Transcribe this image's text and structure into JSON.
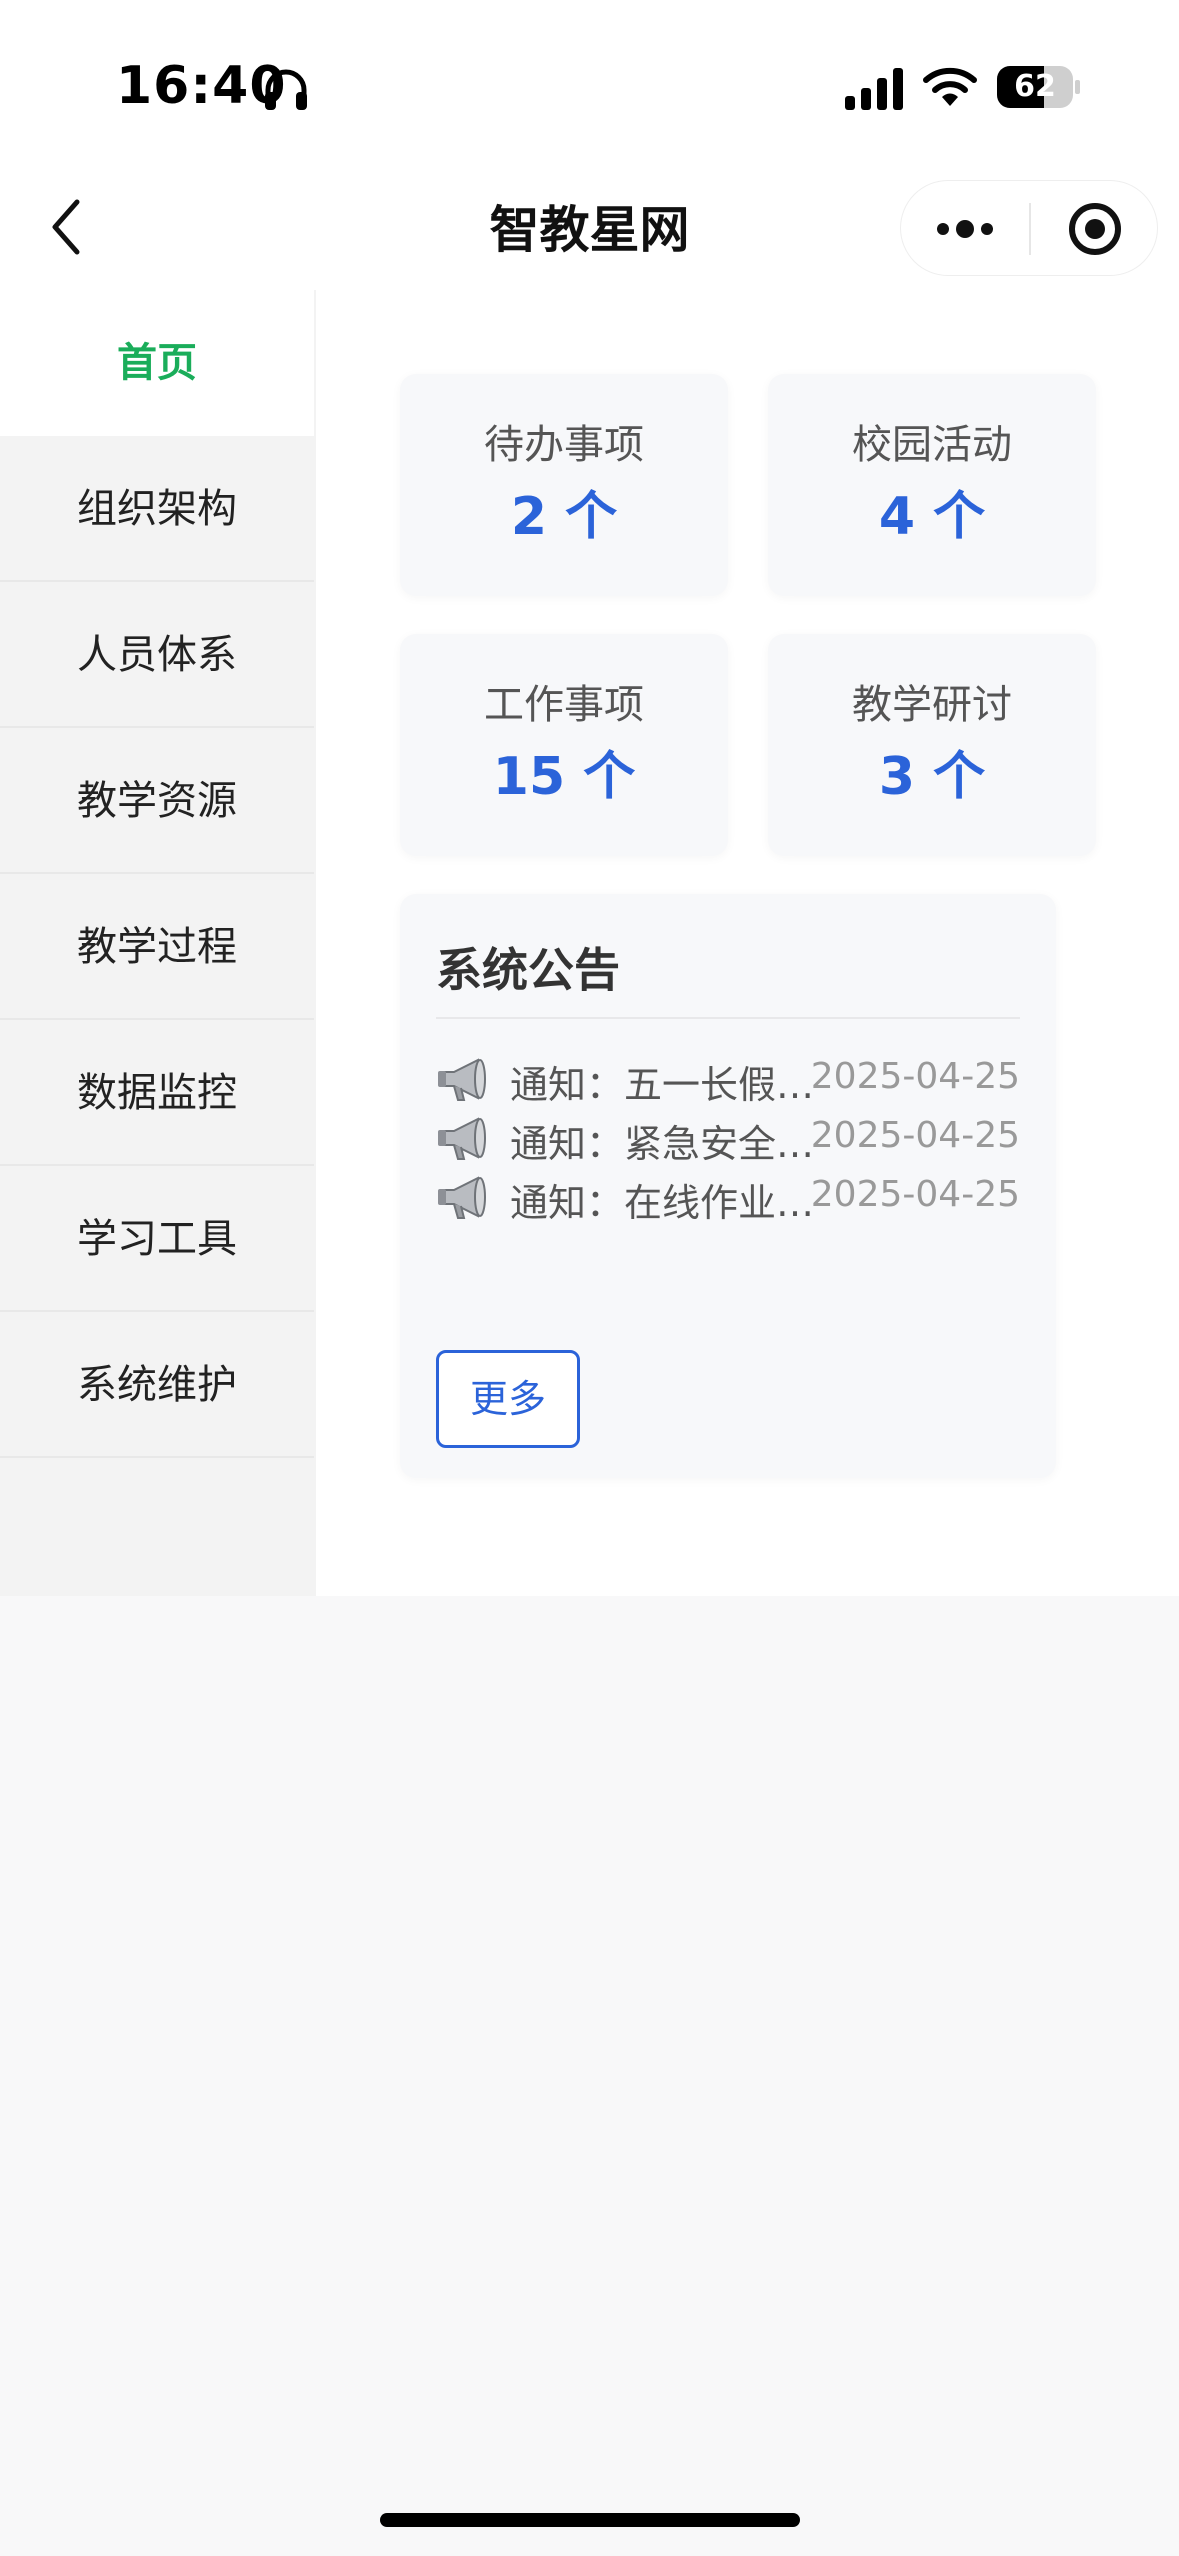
{
  "status_bar": {
    "time": "16:40",
    "battery": "62",
    "battery_level": 0.62
  },
  "nav": {
    "title": "智教星网",
    "back_icon": "chevron-left-icon",
    "more_icon": "more-dots-icon",
    "close_icon": "target-circle-icon"
  },
  "sidebar": {
    "items": [
      {
        "label": "首页",
        "active": true
      },
      {
        "label": "组织架构"
      },
      {
        "label": "人员体系"
      },
      {
        "label": "教学资源"
      },
      {
        "label": "教学过程"
      },
      {
        "label": "数据监控"
      },
      {
        "label": "学习工具"
      },
      {
        "label": "系统维护"
      }
    ]
  },
  "stats": [
    {
      "label": "待办事项",
      "value": "2 个"
    },
    {
      "label": "校园活动",
      "value": "4 个"
    },
    {
      "label": "工作事项",
      "value": "15 个"
    },
    {
      "label": "教学研讨",
      "value": "3 个"
    }
  ],
  "notices": {
    "title": "系统公告",
    "items": [
      {
        "text": "通知：五一长假…",
        "date": "2025-04-25",
        "icon": "megaphone-icon"
      },
      {
        "text": "通知：紧急安全…",
        "date": "2025-04-25",
        "icon": "megaphone-icon"
      },
      {
        "text": "通知：在线作业…",
        "date": "2025-04-25",
        "icon": "megaphone-icon"
      }
    ],
    "more_label": "更多"
  },
  "colors": {
    "accent_green": "#1aad5a",
    "accent_blue": "#2b63d9"
  }
}
